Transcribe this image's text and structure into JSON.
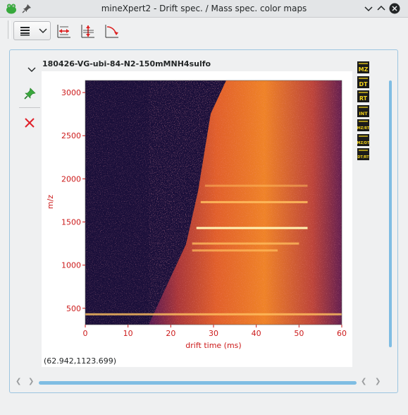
{
  "window": {
    "title": "mineXpert2 - Drift spec. / Mass spec. color maps"
  },
  "plot": {
    "title": "180426-VG-ubi-84-N2-150mMNH4sulfo",
    "coordinates": "(62.942,1123.699)",
    "x_label": "drift time (ms)",
    "y_label": "m/z",
    "x_ticks": [
      "0",
      "10",
      "20",
      "30",
      "40",
      "50",
      "60"
    ],
    "y_ticks": [
      "3000",
      "2500",
      "2000",
      "1500",
      "1000",
      "500"
    ],
    "x_range": [
      0,
      60
    ],
    "y_range": [
      310,
      3140
    ]
  },
  "side_buttons": [
    "MZ",
    "DT",
    "RT",
    "INT",
    "MZ/RT",
    "MZ/DT",
    "DT/RT"
  ],
  "colors": {
    "accent": "#3daee9",
    "axis": "#cc1a1a",
    "heatmap_background": "#1a0f3a",
    "heatmap_hot": "#ff8a1f"
  },
  "chart_data": {
    "type": "heatmap",
    "title": "180426-VG-ubi-84-N2-150mMNH4sulfo",
    "xlabel": "drift time (ms)",
    "ylabel": "m/z",
    "xlim": [
      0,
      60
    ],
    "ylim": [
      310,
      3140
    ],
    "x_ticks": [
      0,
      10,
      20,
      30,
      40,
      50,
      60
    ],
    "y_ticks": [
      500,
      1000,
      1500,
      2000,
      2500,
      3000
    ],
    "intensity_bands": [
      {
        "mz": 430,
        "drift_time_start": 0,
        "drift_time_end": 60,
        "level": 0.8
      },
      {
        "mz": 1170,
        "drift_time_start": 25,
        "drift_time_end": 45,
        "level": 0.7
      },
      {
        "mz": 1250,
        "drift_time_start": 25,
        "drift_time_end": 50,
        "level": 0.75
      },
      {
        "mz": 1430,
        "drift_time_start": 26,
        "drift_time_end": 52,
        "level": 1.0
      },
      {
        "mz": 1730,
        "drift_time_start": 27,
        "drift_time_end": 52,
        "level": 0.85
      },
      {
        "mz": 1920,
        "drift_time_start": 28,
        "drift_time_end": 52,
        "level": 0.5
      }
    ]
  }
}
